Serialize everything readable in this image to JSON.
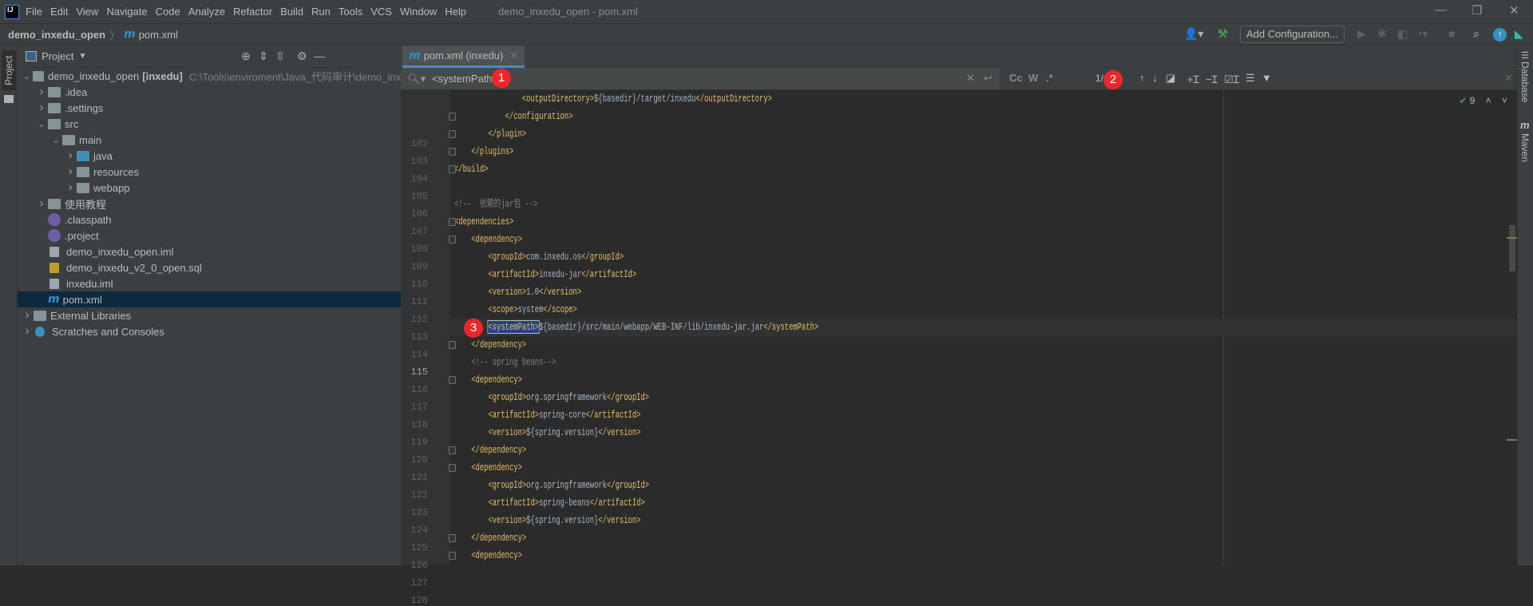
{
  "window": {
    "title": "demo_inxedu_open - pom.xml",
    "logo": "IJ",
    "min_icon": "minimize-icon",
    "max_icon": "restore-icon",
    "close_icon": "close-icon"
  },
  "menu": [
    "File",
    "Edit",
    "View",
    "Navigate",
    "Code",
    "Analyze",
    "Refactor",
    "Build",
    "Run",
    "Tools",
    "VCS",
    "Window",
    "Help"
  ],
  "navbar": {
    "project": "demo_inxedu_open",
    "file": "pom.xml",
    "add_configuration": "Add Configuration..."
  },
  "left_stripe": {
    "project_label": "Project"
  },
  "project_panel": {
    "title": "Project",
    "tree": [
      {
        "depth": 0,
        "arrow": "down",
        "icon": "module",
        "label": "demo_inxedu_open",
        "bold": "[inxedu]",
        "path": "C:\\Tools\\enviroment\\Java_代码审计\\demo_inx"
      },
      {
        "depth": 1,
        "arrow": "right",
        "icon": "folder",
        "label": ".idea"
      },
      {
        "depth": 1,
        "arrow": "right",
        "icon": "folder",
        "label": ".settings"
      },
      {
        "depth": 1,
        "arrow": "down",
        "icon": "folder",
        "label": "src"
      },
      {
        "depth": 2,
        "arrow": "down",
        "icon": "folder",
        "label": "main"
      },
      {
        "depth": 3,
        "arrow": "right",
        "icon": "folder-blue",
        "label": "java"
      },
      {
        "depth": 3,
        "arrow": "right",
        "icon": "folder-resources",
        "label": "resources"
      },
      {
        "depth": 3,
        "arrow": "right",
        "icon": "folder-web",
        "label": "webapp"
      },
      {
        "depth": 1,
        "arrow": "right",
        "icon": "folder",
        "label": "使用教程"
      },
      {
        "depth": 1,
        "arrow": "",
        "icon": "eclipse",
        "label": ".classpath"
      },
      {
        "depth": 1,
        "arrow": "",
        "icon": "eclipse",
        "label": ".project"
      },
      {
        "depth": 1,
        "arrow": "",
        "icon": "iml",
        "label": "demo_inxedu_open.iml"
      },
      {
        "depth": 1,
        "arrow": "",
        "icon": "sql",
        "label": "demo_inxedu_v2_0_open.sql"
      },
      {
        "depth": 1,
        "arrow": "",
        "icon": "iml",
        "label": "inxedu.iml"
      },
      {
        "depth": 1,
        "arrow": "",
        "icon": "maven",
        "label": "pom.xml",
        "selected": true
      },
      {
        "depth": 0,
        "arrow": "right",
        "icon": "libraries",
        "label": "External Libraries"
      },
      {
        "depth": 0,
        "arrow": "right",
        "icon": "scratches",
        "label": "Scratches and Consoles"
      }
    ]
  },
  "editor": {
    "tab_label": "pom.xml (inxedu)",
    "find": {
      "query": "<systemPath>",
      "match_count": "1/4",
      "case": "Cc",
      "words": "W",
      "regex": ".*"
    },
    "inspection_count": "9",
    "current_line": 115,
    "lines": [
      {
        "n": 102,
        "t": [
          [
            "tag",
            "                <outputDirectory>"
          ],
          [
            "txt",
            "${basedir}/target/inxedu"
          ],
          [
            "tag",
            "</outputDirectory>"
          ]
        ]
      },
      {
        "n": 103,
        "fold": true,
        "t": [
          [
            "tag",
            "            </configuration>"
          ]
        ]
      },
      {
        "n": 104,
        "fold": true,
        "t": [
          [
            "tag",
            "        </plugin>"
          ]
        ]
      },
      {
        "n": 105,
        "fold": true,
        "t": [
          [
            "tag",
            "    </plugins>"
          ]
        ]
      },
      {
        "n": 106,
        "fold": true,
        "t": [
          [
            "tag",
            "</build>"
          ]
        ]
      },
      {
        "n": 107,
        "t": []
      },
      {
        "n": 108,
        "t": [
          [
            "cmt",
            "<!--  依赖的jar包 -->"
          ]
        ]
      },
      {
        "n": 109,
        "fold": true,
        "t": [
          [
            "tag",
            "<dependencies>"
          ]
        ]
      },
      {
        "n": 110,
        "fold": true,
        "t": [
          [
            "tag",
            "    <dependency>"
          ]
        ]
      },
      {
        "n": 111,
        "t": [
          [
            "tag",
            "        <groupId>"
          ],
          [
            "txt",
            "com.inxedu.os"
          ],
          [
            "tag",
            "</groupId>"
          ]
        ]
      },
      {
        "n": 112,
        "t": [
          [
            "tag",
            "        <artifactId>"
          ],
          [
            "txt",
            "inxedu-jar"
          ],
          [
            "tag",
            "</artifactId>"
          ]
        ]
      },
      {
        "n": 113,
        "t": [
          [
            "tag",
            "        <version>"
          ],
          [
            "txt",
            "1.0"
          ],
          [
            "tag",
            "</version>"
          ]
        ]
      },
      {
        "n": 114,
        "t": [
          [
            "tag",
            "        <scope>"
          ],
          [
            "txt",
            "system"
          ],
          [
            "tag",
            "</scope>"
          ]
        ]
      },
      {
        "n": 115,
        "t": [
          [
            "txt",
            "        "
          ],
          [
            "hl",
            "<systemPath>"
          ],
          [
            "txt",
            "${basedir}/src/main/webapp/WEB-INF/lib/inxedu-jar.jar"
          ],
          [
            "tag",
            "</systemPath>"
          ]
        ]
      },
      {
        "n": 116,
        "fold": true,
        "t": [
          [
            "tag",
            "    </dependency>"
          ]
        ]
      },
      {
        "n": 117,
        "t": [
          [
            "cmt",
            "    <!-- spring beans-->"
          ]
        ]
      },
      {
        "n": 118,
        "fold": true,
        "t": [
          [
            "tag",
            "    <dependency>"
          ]
        ]
      },
      {
        "n": 119,
        "t": [
          [
            "tag",
            "        <groupId>"
          ],
          [
            "txt",
            "org.springframework"
          ],
          [
            "tag",
            "</groupId>"
          ]
        ]
      },
      {
        "n": 120,
        "t": [
          [
            "tag",
            "        <artifactId>"
          ],
          [
            "txt",
            "spring-core"
          ],
          [
            "tag",
            "</artifactId>"
          ]
        ]
      },
      {
        "n": 121,
        "t": [
          [
            "tag",
            "        <version>"
          ],
          [
            "txt",
            "${spring.version}"
          ],
          [
            "tag",
            "</version>"
          ]
        ]
      },
      {
        "n": 122,
        "fold": true,
        "t": [
          [
            "tag",
            "    </dependency>"
          ]
        ]
      },
      {
        "n": 123,
        "fold": true,
        "t": [
          [
            "tag",
            "    <dependency>"
          ]
        ]
      },
      {
        "n": 124,
        "t": [
          [
            "tag",
            "        <groupId>"
          ],
          [
            "txt",
            "org.springframework"
          ],
          [
            "tag",
            "</groupId>"
          ]
        ]
      },
      {
        "n": 125,
        "t": [
          [
            "tag",
            "        <artifactId>"
          ],
          [
            "txt",
            "spring-beans"
          ],
          [
            "tag",
            "</artifactId>"
          ]
        ]
      },
      {
        "n": 126,
        "t": [
          [
            "tag",
            "        <version>"
          ],
          [
            "txt",
            "${spring.version}"
          ],
          [
            "tag",
            "</version>"
          ]
        ]
      },
      {
        "n": 127,
        "fold": true,
        "t": [
          [
            "tag",
            "    </dependency>"
          ]
        ]
      },
      {
        "n": 128,
        "fold": true,
        "t": [
          [
            "tag",
            "    <dependency>"
          ]
        ]
      }
    ]
  },
  "right_stripe": {
    "database": "Database",
    "maven": "Maven"
  },
  "annotations": {
    "badge1": "1",
    "badge2": "2",
    "badge3": "3",
    "color": "#f0262b"
  },
  "colors": {
    "tag": "#e8bf6a",
    "text": "#a9b7c6",
    "comment": "#808080",
    "selection": "#214283"
  }
}
